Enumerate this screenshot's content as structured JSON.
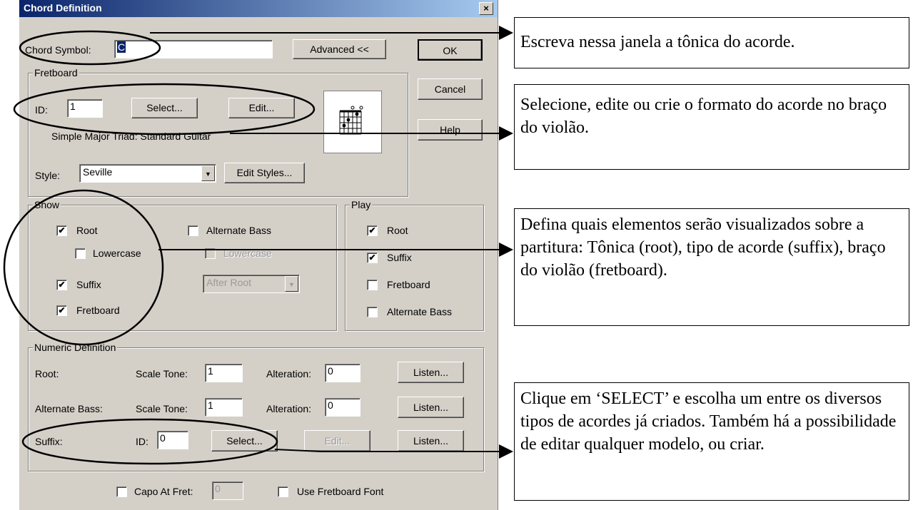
{
  "dialog": {
    "title": "Chord Definition",
    "close": "×",
    "chord_symbol_label": "Chord Symbol:",
    "chord_symbol_value": "C",
    "advanced_button": "Advanced <<",
    "ok_button": "OK",
    "cancel_button": "Cancel",
    "help_button": "Help"
  },
  "fretboard": {
    "group_title": "Fretboard",
    "id_label": "ID:",
    "id_value": "1",
    "select_button": "Select...",
    "edit_button": "Edit...",
    "description": "Simple Major Triad: Standard Guitar",
    "style_label": "Style:",
    "style_value": "Seville",
    "edit_styles_button": "Edit Styles..."
  },
  "show": {
    "group_title": "Show",
    "root": {
      "label": "Root",
      "checked": true
    },
    "lowercase": {
      "label": "Lowercase",
      "checked": false
    },
    "suffix": {
      "label": "Suffix",
      "checked": true
    },
    "fretboard": {
      "label": "Fretboard",
      "checked": true
    },
    "alternate_bass": {
      "label": "Alternate Bass",
      "checked": false
    },
    "alt_lowercase": {
      "label": "Lowercase",
      "checked": false
    },
    "position_value": "After Root"
  },
  "play": {
    "group_title": "Play",
    "root": {
      "label": "Root",
      "checked": true
    },
    "suffix": {
      "label": "Suffix",
      "checked": true
    },
    "fretboard": {
      "label": "Fretboard",
      "checked": false
    },
    "alternate_bass": {
      "label": "Alternate Bass",
      "checked": false
    }
  },
  "numeric": {
    "group_title": "Numeric Definition",
    "root_label": "Root:",
    "alt_bass_label": "Alternate Bass:",
    "suffix_label": "Suffix:",
    "scale_tone_label": "Scale Tone:",
    "alteration_label": "Alteration:",
    "root_scale_tone": "1",
    "root_alteration": "0",
    "alt_scale_tone": "1",
    "alt_alteration": "0",
    "suffix_id_label": "ID:",
    "suffix_id_value": "0",
    "select_button": "Select...",
    "edit_button": "Edit...",
    "listen_button": "Listen..."
  },
  "bottom": {
    "capo_label": "Capo At Fret:",
    "capo_value": "0",
    "use_font_label": "Use Fretboard Font"
  },
  "notes": {
    "note1": "Escreva nessa janela a tônica do acorde.",
    "note2": "Selecione, edite ou crie o formato do acorde no braço do violão.",
    "note3": "Defina quais elementos serão visualizados sobre a partitura: Tônica (root), tipo de acorde (suffix), braço do violão (fretboard).",
    "note4": "Clique em ‘SELECT’ e escolha um entre os diversos tipos de acordes já criados. Também há a possibilidade de editar qualquer modelo, ou criar."
  }
}
